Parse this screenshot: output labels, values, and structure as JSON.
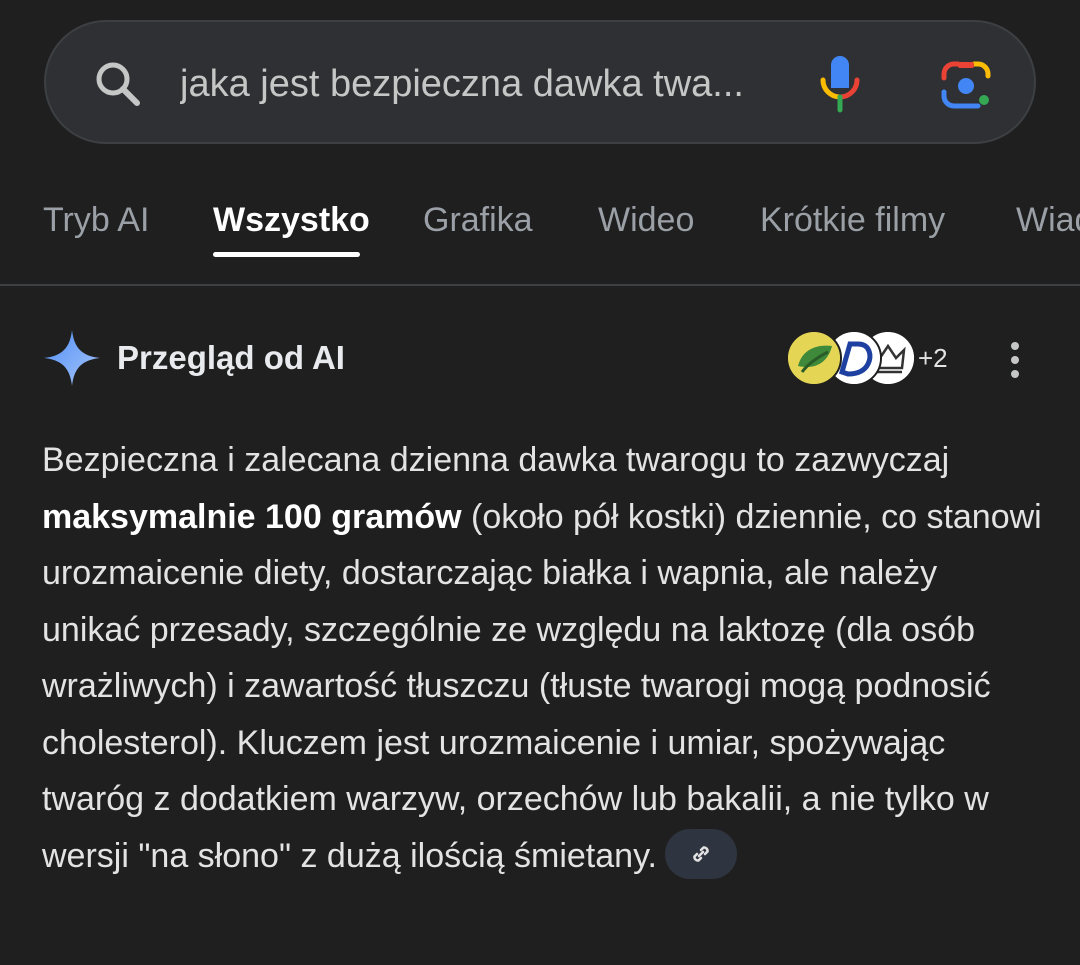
{
  "search": {
    "query": "jaka jest bezpieczna dawka twa..."
  },
  "tabs": [
    {
      "label": "Tryb AI"
    },
    {
      "label": "Wszystko",
      "active": true
    },
    {
      "label": "Grafika"
    },
    {
      "label": "Wideo"
    },
    {
      "label": "Krótkie filmy"
    },
    {
      "label": "Wiadomości"
    }
  ],
  "ai_overview": {
    "title": "Przegląd od AI",
    "sources_more": "+2",
    "body": {
      "part1": "Bezpieczna i zalecana dzienna dawka twarogu to zazwyczaj ",
      "bold": "maksymalnie 100 gramów",
      "part2": " (około pół kostki) dziennie, co stanowi urozmaicenie diety, dostarczając białka i wapnia, ale należy unikać przesady, szczególnie ze względu na laktozę (dla osób wrażliwych) i zawartość tłuszczu (tłuste twarogi mogą podnosić cholesterol). Kluczem jest urozmaicenie i umiar, spożywając twaróg z dodatkiem warzyw, orzechów lub bakalii, a nie tylko w wersji \"na słono\" z dużą ilością śmietany."
    }
  },
  "icons": {
    "search": "search-icon",
    "mic": "mic-icon",
    "lens": "google-lens-icon",
    "sparkle": "ai-sparkle-icon",
    "menu": "more-vertical-icon",
    "link": "link-icon"
  },
  "colors": {
    "background": "#1f1f1f",
    "search_bg": "#2f3033",
    "text": "#e3e3e3",
    "muted": "#9aa0a6",
    "google_blue": "#4285f4",
    "google_red": "#ea4335",
    "google_yellow": "#fbbc04",
    "google_green": "#34a853"
  }
}
